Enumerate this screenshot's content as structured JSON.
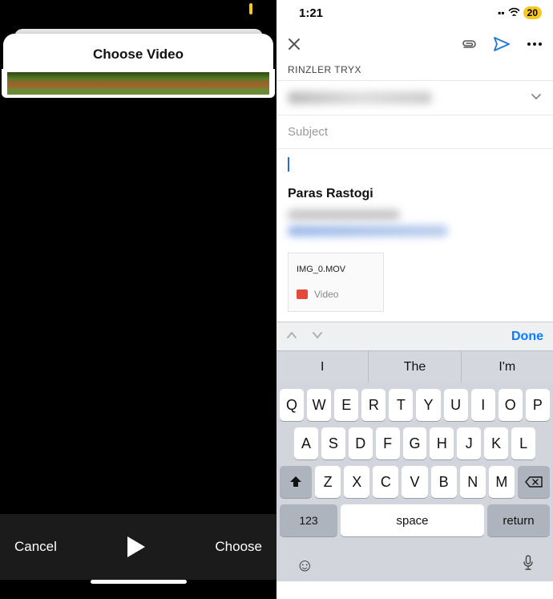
{
  "left": {
    "sheet_title": "Choose Video",
    "cancel": "Cancel",
    "choose": "Choose"
  },
  "right": {
    "status": {
      "time": "1:21",
      "battery": "20"
    },
    "from": "RINZLER TRYX",
    "subject_placeholder": "Subject",
    "sender_name": "Paras Rastogi",
    "attachment": {
      "filename": "IMG_0.MOV",
      "kind": "Video"
    },
    "accessory": {
      "done": "Done"
    },
    "suggestions": [
      "I",
      "The",
      "I'm"
    ],
    "keys": {
      "row1": [
        "Q",
        "W",
        "E",
        "R",
        "T",
        "Y",
        "U",
        "I",
        "O",
        "P"
      ],
      "row2": [
        "A",
        "S",
        "D",
        "F",
        "G",
        "H",
        "J",
        "K",
        "L"
      ],
      "row3": [
        "Z",
        "X",
        "C",
        "V",
        "B",
        "N",
        "M"
      ],
      "num": "123",
      "space": "space",
      "return": "return"
    }
  }
}
